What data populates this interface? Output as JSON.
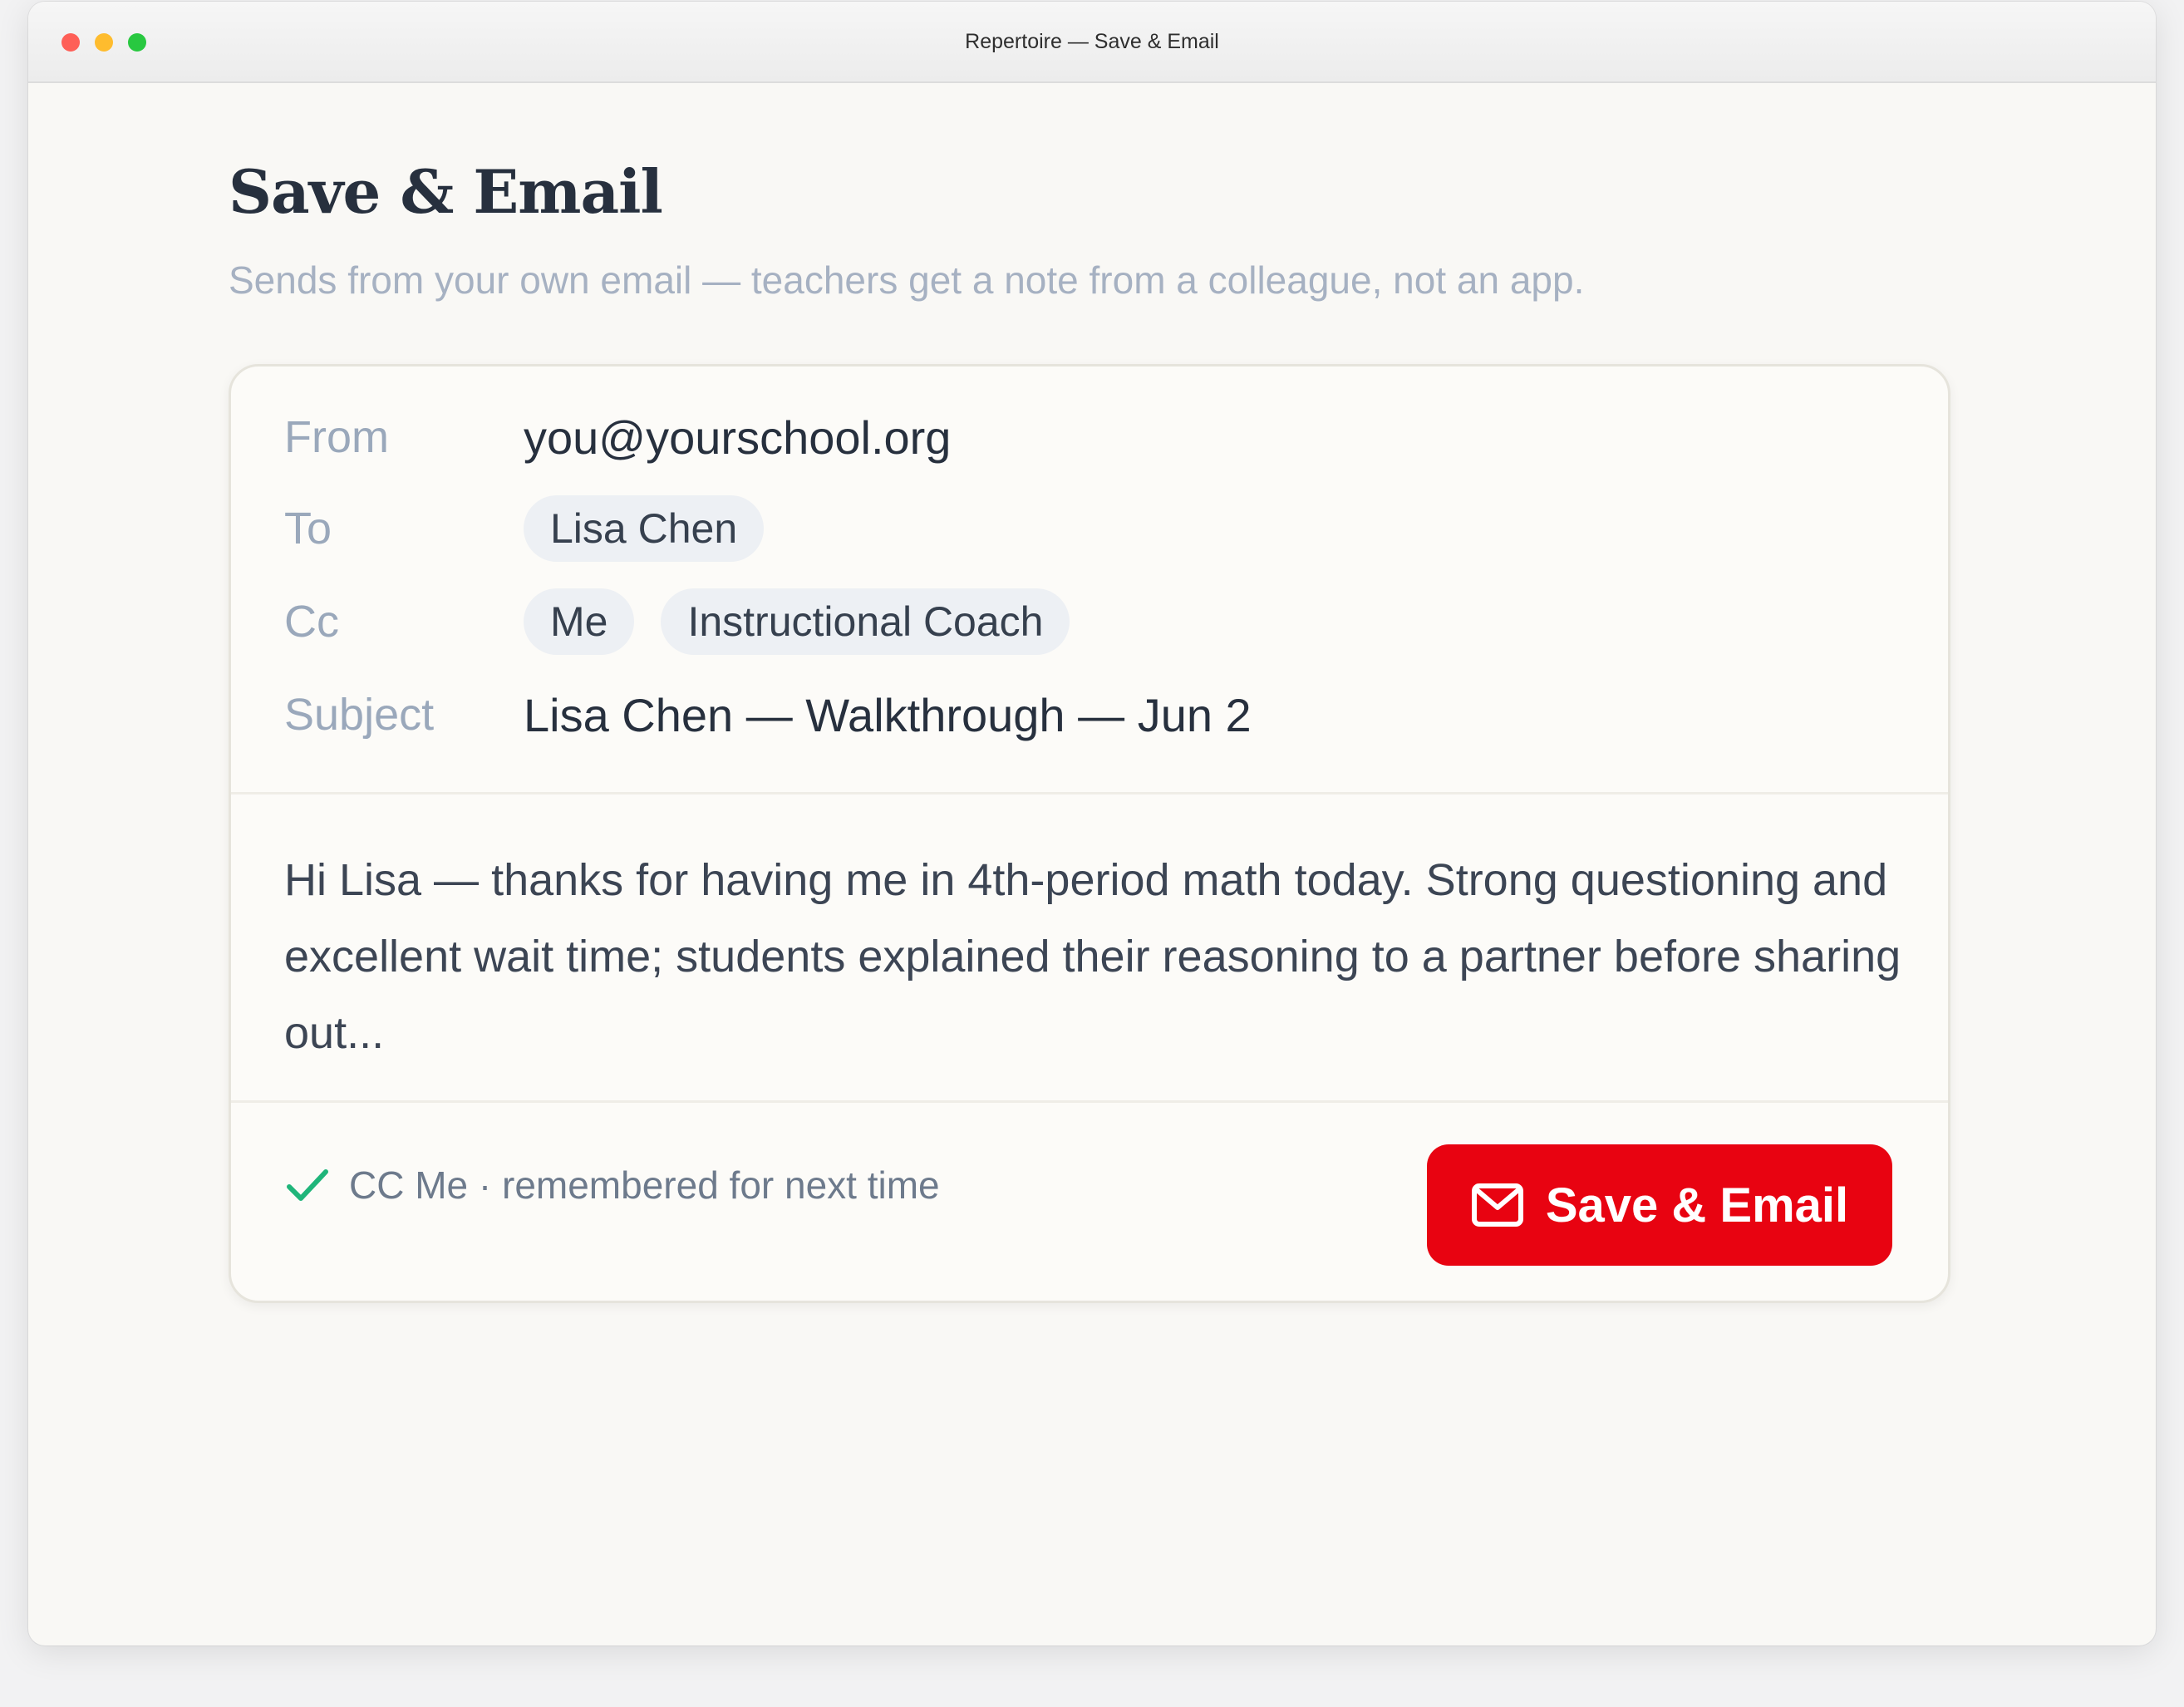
{
  "window": {
    "title": "Repertoire — Save & Email"
  },
  "page": {
    "title": "Save & Email",
    "subtitle": "Sends from your own email — teachers get a note from a colleague, not an app."
  },
  "email": {
    "from_label": "From",
    "from_value": "you@yourschool.org",
    "to_label": "To",
    "to_recipients": [
      "Lisa Chen"
    ],
    "cc_label": "Cc",
    "cc_recipients": [
      "Me",
      "Instructional Coach"
    ],
    "subject_label": "Subject",
    "subject_value": "Lisa Chen — Walkthrough — Jun 2",
    "body": "Hi Lisa — thanks for having me in 4th-period math today. Strong questioning and excellent wait time; students explained their reasoning to a partner before sharing out..."
  },
  "footer": {
    "check_icon": "check-icon",
    "note": "CC Me · remembered for next time",
    "save_button_label": "Save & Email",
    "save_button_icon": "mail-icon"
  },
  "colors": {
    "accent": "#e80311",
    "check": "#1fb57a"
  }
}
